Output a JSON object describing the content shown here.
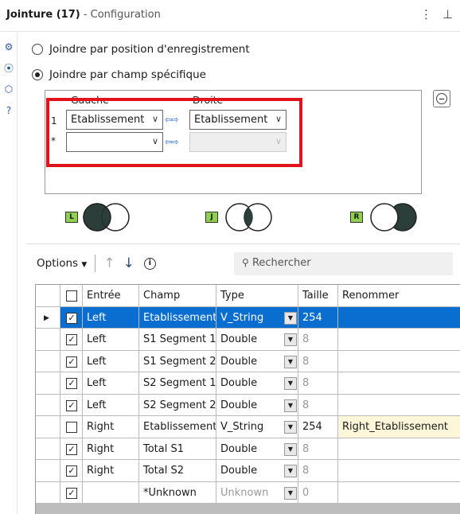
{
  "header": {
    "title": "Jointure (17)",
    "subtitle": "- Configuration",
    "more_icon": "⋮",
    "pin_icon": "⊥"
  },
  "sidebar": [
    "gear-icon",
    "tool-icon",
    "tag-icon",
    "help-icon"
  ],
  "options": {
    "by_position": "Joindre par position d'enregistrement",
    "by_field": "Joindre par champ spécifique"
  },
  "join_fields": {
    "left_header": "Gauche",
    "right_header": "Droite",
    "rows": [
      {
        "num": "1",
        "left": "Etablissement",
        "right": "Etablissement"
      },
      {
        "num": "*",
        "left": "",
        "right": ""
      }
    ]
  },
  "venn": [
    "L",
    "J",
    "R"
  ],
  "toolbar": {
    "options_label": "Options",
    "search_placeholder": "Rechercher"
  },
  "table": {
    "columns": [
      "Entrée",
      "Champ",
      "Type",
      "Taille",
      "Renommer"
    ],
    "rows": [
      {
        "checked": true,
        "input": "Left",
        "field": "Etablissement",
        "type": "V_String",
        "size": "254",
        "rename": "",
        "selected": true
      },
      {
        "checked": true,
        "input": "Left",
        "field": "S1 Segment 1",
        "type": "Double",
        "size": "8",
        "rename": ""
      },
      {
        "checked": true,
        "input": "Left",
        "field": "S1 Segment 2",
        "type": "Double",
        "size": "8",
        "rename": ""
      },
      {
        "checked": true,
        "input": "Left",
        "field": "S2 Segment 1",
        "type": "Double",
        "size": "8",
        "rename": ""
      },
      {
        "checked": true,
        "input": "Left",
        "field": "S2 Segment 2",
        "type": "Double",
        "size": "8",
        "rename": ""
      },
      {
        "checked": false,
        "input": "Right",
        "field": "Etablissement",
        "type": "V_String",
        "size": "254",
        "rename": "Right_Etablissement"
      },
      {
        "checked": true,
        "input": "Right",
        "field": "Total S1",
        "type": "Double",
        "size": "8",
        "rename": ""
      },
      {
        "checked": true,
        "input": "Right",
        "field": "Total S2",
        "type": "Double",
        "size": "8",
        "rename": ""
      },
      {
        "checked": true,
        "input": "",
        "field": "*Unknown",
        "type": "Unknown",
        "size": "0",
        "rename": ""
      }
    ]
  },
  "colors": {
    "selection": "#0a6ed1",
    "highlight": "#e3131b",
    "rename_bg": "#fdf6d8",
    "badge": "#8fd14f"
  }
}
